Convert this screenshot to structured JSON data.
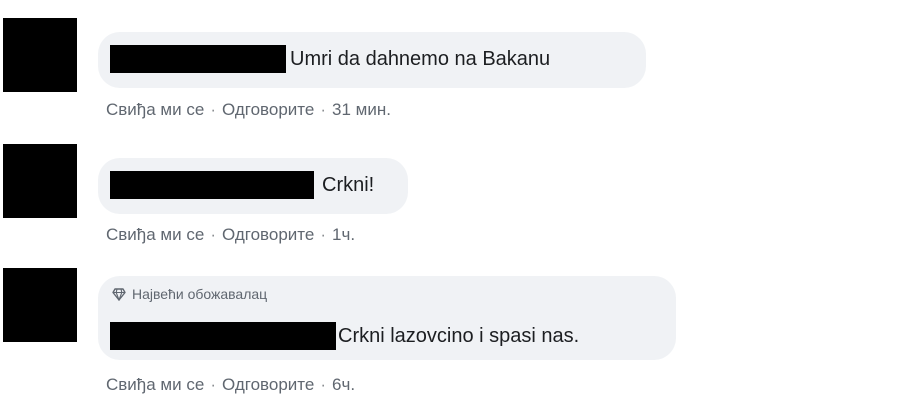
{
  "comments": [
    {
      "text": "Umri da dahnemo na Bakanu",
      "like": "Свиђа ми се",
      "reply": "Одговорите",
      "time": "31 мин."
    },
    {
      "text": "Crkni!",
      "like": "Свиђа ми се",
      "reply": "Одговорите",
      "time": "1ч."
    },
    {
      "badge": "Највећи обожавалац",
      "text": "Crkni lazovcino i spasi nas.",
      "like": "Свиђа ми се",
      "reply": "Одговорите",
      "time": "6ч."
    }
  ],
  "separator": "·",
  "icons": {
    "badge": "diamond-icon"
  }
}
